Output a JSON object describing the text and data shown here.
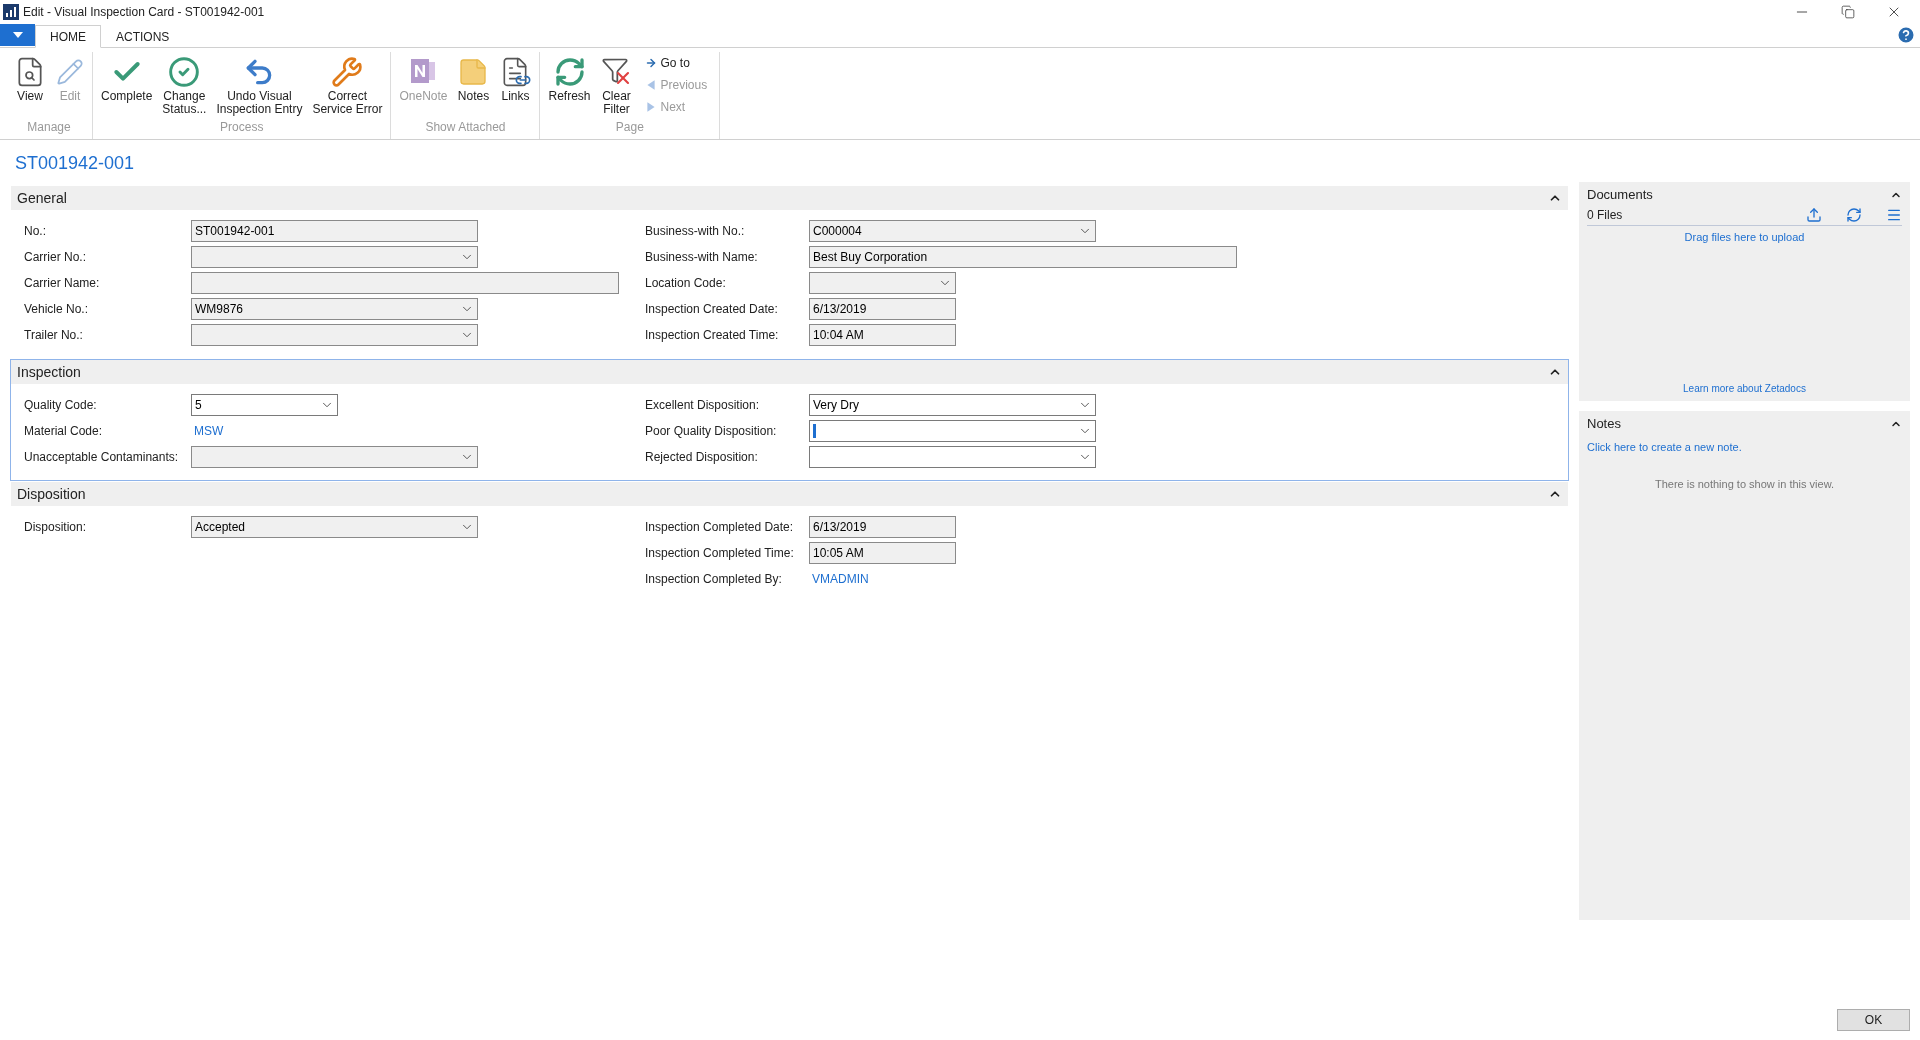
{
  "window": {
    "title": "Edit - Visual Inspection Card - ST001942-001"
  },
  "tabs": [
    {
      "label": "HOME",
      "selected": true
    },
    {
      "label": "ACTIONS",
      "selected": false
    }
  ],
  "ribbon": [
    {
      "name": "Manage",
      "buttons": [
        {
          "label": "View",
          "disabled": false
        },
        {
          "label": "Edit",
          "disabled": true
        }
      ]
    },
    {
      "name": "Process",
      "buttons": [
        {
          "label": "Complete",
          "disabled": false
        },
        {
          "label": "Change\nStatus...",
          "disabled": false
        },
        {
          "label": "Undo Visual\nInspection Entry",
          "disabled": false
        },
        {
          "label": "Correct\nService Error",
          "disabled": false
        }
      ]
    },
    {
      "name": "Show Attached",
      "buttons": [
        {
          "label": "OneNote",
          "disabled": true
        },
        {
          "label": "Notes",
          "disabled": false
        },
        {
          "label": "Links",
          "disabled": false
        }
      ]
    },
    {
      "name": "Page",
      "buttons": [
        {
          "label": "Refresh",
          "disabled": false
        },
        {
          "label": "Clear\nFilter",
          "disabled": false
        }
      ],
      "nav_items": [
        {
          "label": "Go to",
          "disabled": false
        },
        {
          "label": "Previous",
          "disabled": true
        },
        {
          "label": "Next",
          "disabled": true
        }
      ]
    }
  ],
  "record_title": "ST001942-001",
  "sections": [
    {
      "title": "General",
      "expanded": true,
      "focused": false,
      "left": [
        {
          "label": "No.:",
          "kind": "text",
          "value": "ST001942-001",
          "editable": false
        },
        {
          "label": "Carrier No.:",
          "kind": "dropdown",
          "editable": false
        },
        {
          "label": "Carrier Name:",
          "kind": "wide",
          "editable": false
        },
        {
          "label": "Vehicle No.:",
          "kind": "dropdown",
          "value": "WM9876",
          "editable": false
        },
        {
          "label": "Trailer No.:",
          "kind": "dropdown",
          "editable": false
        }
      ],
      "right": [
        {
          "label": "Business-with No.:",
          "kind": "dropdown",
          "value": "C000004",
          "editable": false
        },
        {
          "label": "Business-with Name:",
          "kind": "wide",
          "value": "Best Buy Corporation",
          "editable": false
        },
        {
          "label": "Location Code:",
          "kind": "shortdropdown",
          "editable": false
        },
        {
          "label": "Inspection Created Date:",
          "kind": "short",
          "value": "6/13/2019",
          "editable": false
        },
        {
          "label": "Inspection Created Time:",
          "kind": "short",
          "value": "10:04 AM",
          "editable": false
        }
      ]
    },
    {
      "title": "Inspection",
      "expanded": true,
      "focused": true,
      "left": [
        {
          "label": "Quality Code:",
          "kind": "shortdropdown",
          "value": "5",
          "editable": true
        },
        {
          "label": "Material Code:",
          "kind": "link",
          "value": "MSW"
        },
        {
          "label": "Unacceptable Contaminants:",
          "kind": "dropdown",
          "editable": false
        }
      ],
      "right": [
        {
          "label": "Excellent Disposition:",
          "kind": "dropdown",
          "value": "Very Dry",
          "editable": true
        },
        {
          "label": "Poor Quality Disposition:",
          "kind": "dropdown",
          "editable": true,
          "focused": true
        },
        {
          "label": "Rejected Disposition:",
          "kind": "dropdown",
          "editable": true
        }
      ]
    },
    {
      "title": "Disposition",
      "expanded": true,
      "focused": false,
      "left": [
        {
          "label": "Disposition:",
          "kind": "dropdown",
          "value": "Accepted",
          "editable": false
        }
      ],
      "right": [
        {
          "label": "Inspection Completed Date:",
          "kind": "short",
          "value": "6/13/2019",
          "editable": false
        },
        {
          "label": "Inspection Completed Time:",
          "kind": "short",
          "value": "10:05 AM",
          "editable": false
        },
        {
          "label": "Inspection Completed By:",
          "kind": "link",
          "value": "VMADMIN"
        }
      ]
    }
  ],
  "documents": {
    "title": "Documents",
    "expanded": true,
    "count": "0 Files",
    "drop_hint": "Drag files here to upload",
    "learn_more": "Learn more about Zetadocs"
  },
  "notes": {
    "title": "Notes",
    "expanded": true,
    "create_link": "Click here to create a new note.",
    "empty_text": "There is nothing to show in this view."
  },
  "footer": {
    "ok": "OK"
  }
}
